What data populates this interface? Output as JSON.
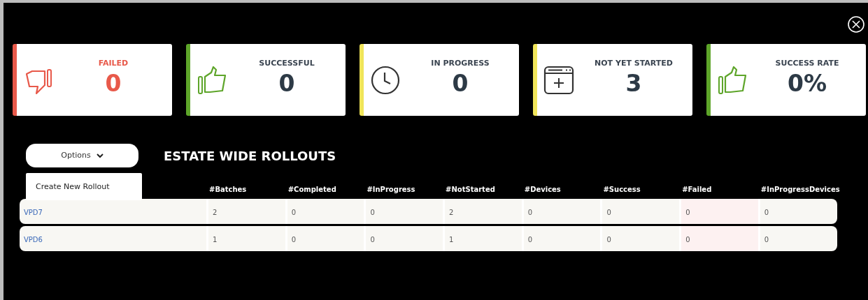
{
  "stats": [
    {
      "kind": "thumbs-down",
      "label": "FAILED",
      "value": "0",
      "color": "#e8594a"
    },
    {
      "kind": "thumbs-up",
      "label": "SUCCESSFUL",
      "value": "0",
      "color": "#5ea52a"
    },
    {
      "kind": "clock",
      "label": "IN PROGRESS",
      "value": "0",
      "color": "#f0e55a"
    },
    {
      "kind": "window-plus",
      "label": "NOT YET STARTED",
      "value": "3",
      "color": "#f0e55a"
    },
    {
      "kind": "thumbs-up",
      "label": "SUCCESS RATE",
      "value": "0%",
      "color": "#5ea52a"
    }
  ],
  "options_button": {
    "label": "Options"
  },
  "options_menu": {
    "items": [
      "Create New Rollout"
    ]
  },
  "section_title": "ESTATE WIDE ROLLOUTS",
  "table": {
    "columns": [
      "#Batches",
      "#Completed",
      "#InProgress",
      "#NotStarted",
      "#Devices",
      "#Success",
      "#Failed",
      "#InProgressDevices"
    ],
    "rows": [
      {
        "name": "VPD7",
        "cells": [
          "2",
          "0",
          "0",
          "2",
          "0",
          "0",
          "0",
          "0"
        ]
      },
      {
        "name": "VPD6",
        "cells": [
          "1",
          "0",
          "0",
          "1",
          "0",
          "0",
          "0",
          "0"
        ]
      }
    ]
  }
}
